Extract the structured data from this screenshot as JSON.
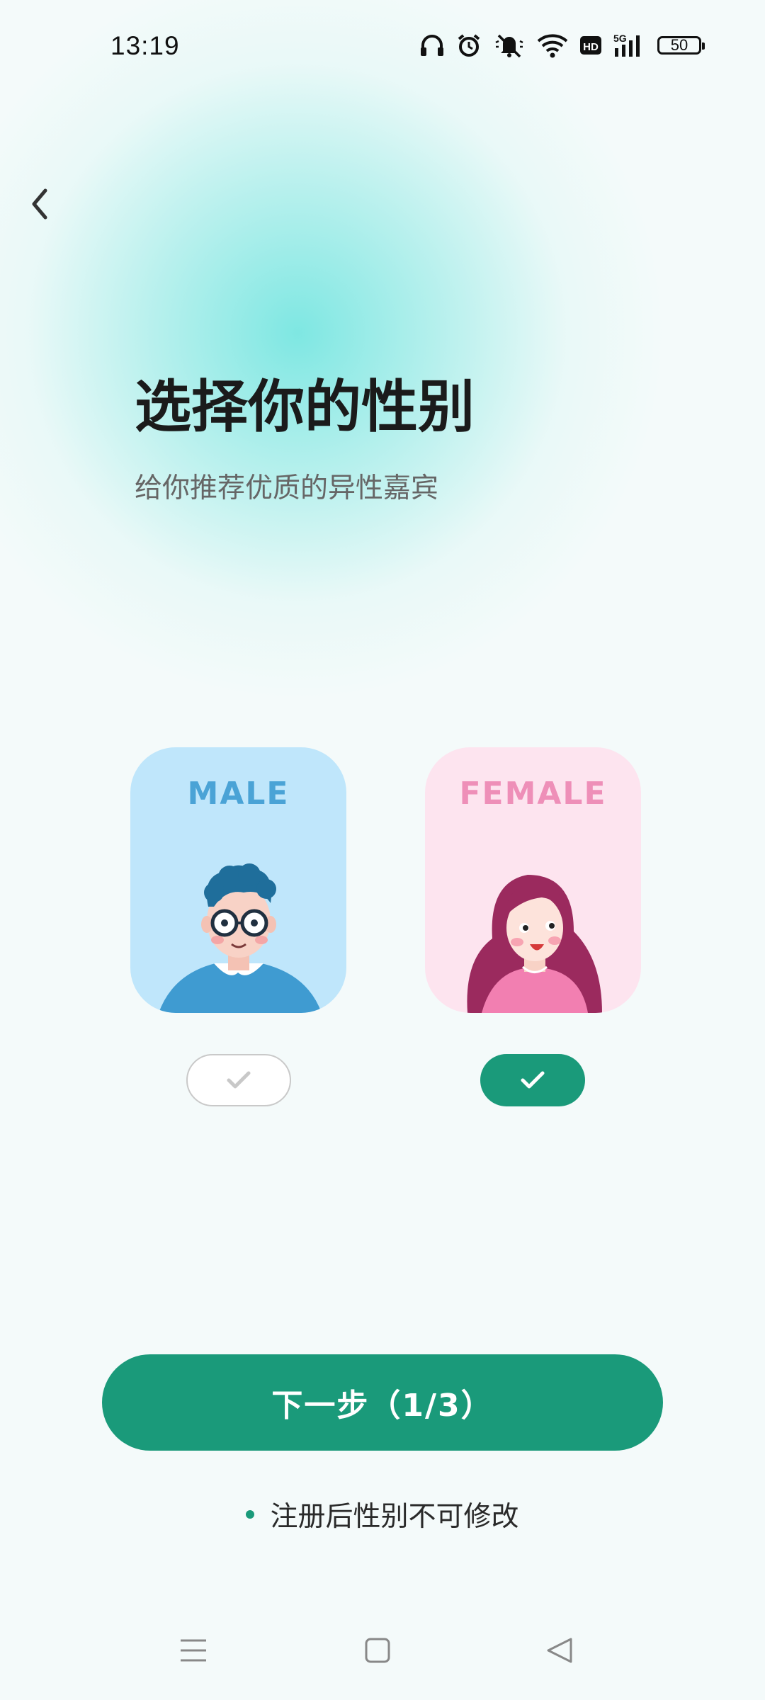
{
  "status_bar": {
    "time": "13:19",
    "battery": "50",
    "icons": [
      "headphones-icon",
      "alarm-icon",
      "mute-icon",
      "wifi-icon",
      "hd-icon",
      "5g-signal-icon",
      "battery-icon"
    ]
  },
  "header": {
    "back_icon": "chevron-left-icon"
  },
  "main": {
    "title": "选择你的性别",
    "subtitle": "给你推荐优质的异性嘉宾"
  },
  "options": [
    {
      "label": "MALE",
      "selected": false
    },
    {
      "label": "FEMALE",
      "selected": true
    }
  ],
  "next_button": {
    "label": "下一步（1/3）"
  },
  "notice": {
    "text": "注册后性别不可修改"
  },
  "nav_bar": {
    "icons": [
      "menu-icon",
      "home-icon",
      "back-icon"
    ]
  },
  "colors": {
    "accent": "#1a9a7a",
    "male_card": "#bfe6fb",
    "female_card": "#fde4ef"
  }
}
